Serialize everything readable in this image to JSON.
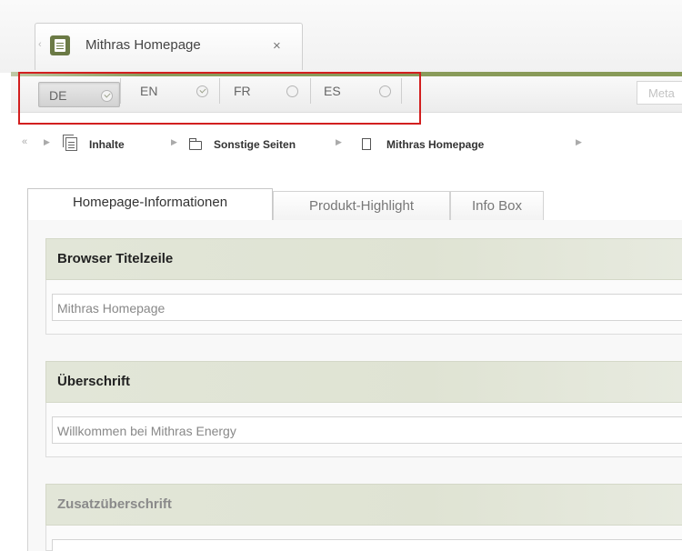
{
  "document_tab": {
    "title": "Mithras Homepage",
    "close_glyph": "×",
    "icon": "document-icon"
  },
  "language_bar": {
    "languages": [
      {
        "code": "DE",
        "state": "check-icon",
        "active": true
      },
      {
        "code": "EN",
        "state": "check-icon",
        "active": false
      },
      {
        "code": "FR",
        "state": "circle-icon",
        "active": false
      },
      {
        "code": "ES",
        "state": "circle-icon",
        "active": false
      }
    ],
    "meta_label": "Meta",
    "highlight_color": "#d21f1f"
  },
  "breadcrumb": {
    "collapse_glyph": "«",
    "items": [
      {
        "label": "Inhalte",
        "icon": "content-stack-icon"
      },
      {
        "label": "Sonstige Seiten",
        "icon": "folder-icon"
      },
      {
        "label": "Mithras Homepage",
        "icon": "page-icon"
      }
    ]
  },
  "tabs": [
    {
      "label": "Homepage-Informationen",
      "active": true
    },
    {
      "label": "Produkt-Highlight",
      "active": false
    },
    {
      "label": "Info Box",
      "active": false
    }
  ],
  "fields": [
    {
      "label": "Browser Titelzeile",
      "value": "Mithras Homepage"
    },
    {
      "label": "Überschrift",
      "value": "Willkommen bei Mithras Energy"
    },
    {
      "label": "Zusatzüberschrift",
      "value": ""
    }
  ],
  "colors": {
    "accent_green": "#889a58",
    "section_header": "#e2e6d8"
  }
}
